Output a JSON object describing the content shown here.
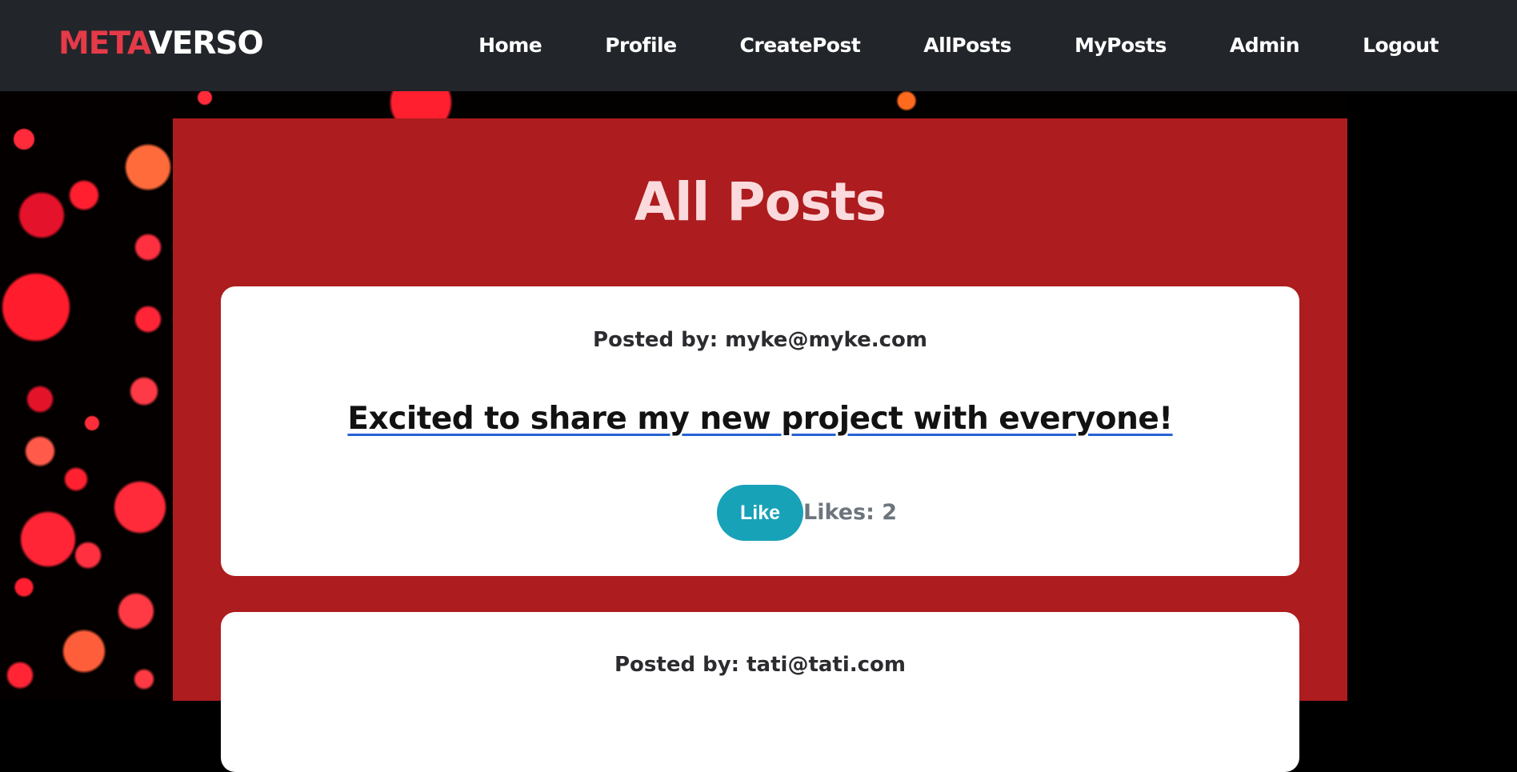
{
  "navbar": {
    "brand_part1": "META",
    "brand_part2": "VERSO",
    "links": [
      {
        "label": "Home"
      },
      {
        "label": "Profile"
      },
      {
        "label": "CreatePost"
      },
      {
        "label": "AllPosts"
      },
      {
        "label": "MyPosts"
      },
      {
        "label": "Admin"
      },
      {
        "label": "Logout"
      }
    ]
  },
  "main": {
    "title": "All Posts",
    "posts": [
      {
        "posted_by": "Posted by: myke@myke.com",
        "content": "Excited to share my new project with everyone!",
        "like_label": "Like",
        "likes_text": "Likes: 2"
      },
      {
        "posted_by": "Posted by: tati@tati.com"
      }
    ]
  },
  "colors": {
    "navbar_bg": "#22252a",
    "brand_accent": "#e53a48",
    "panel_bg": "#ad1c1e",
    "title_color": "#fadadd",
    "like_button": "#17a2b8",
    "likes_text": "#6c757d",
    "content_underline": "#2563d4"
  }
}
